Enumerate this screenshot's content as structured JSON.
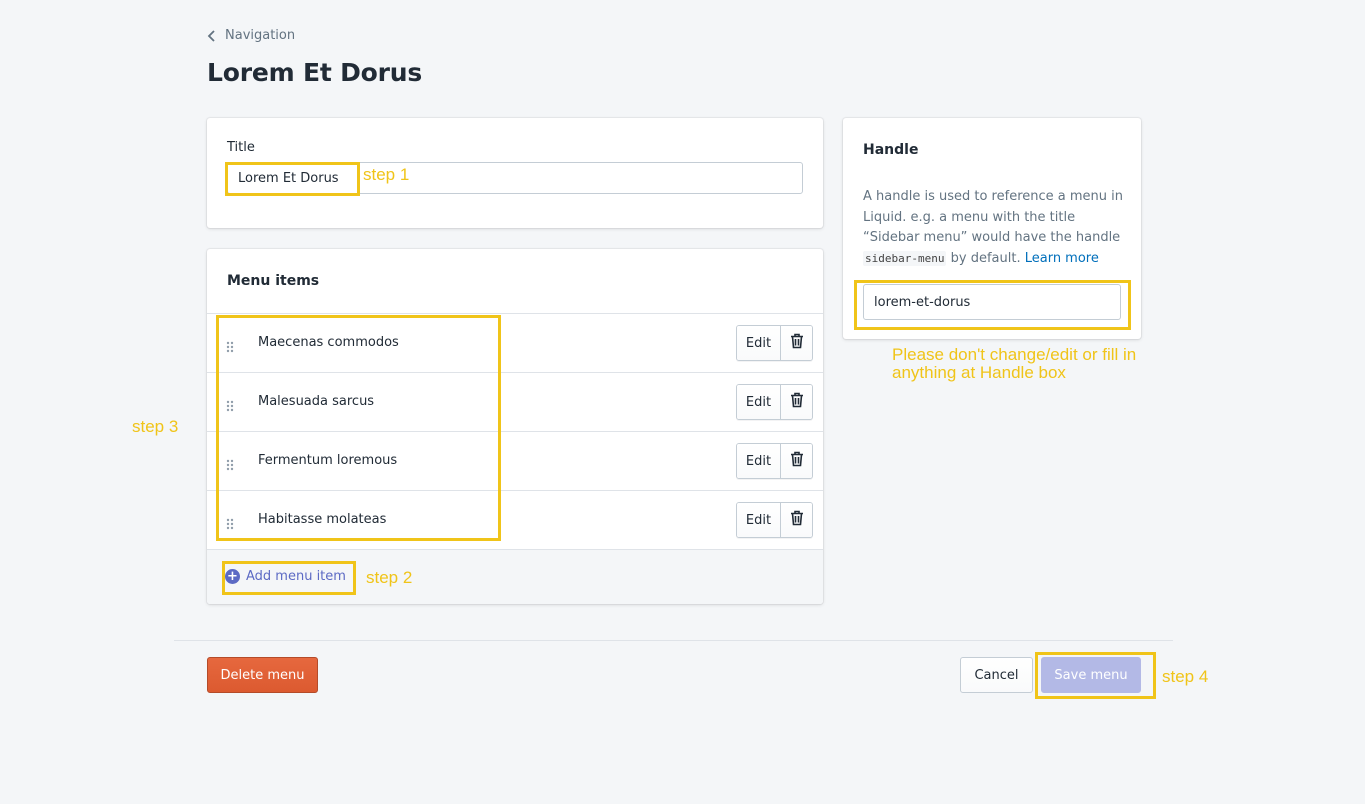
{
  "breadcrumb": {
    "label": "Navigation"
  },
  "page": {
    "title": "Lorem Et Dorus"
  },
  "title_card": {
    "label": "Title",
    "value": "Lorem Et Dorus"
  },
  "menu": {
    "header": "Menu items",
    "items": [
      {
        "label": "Maecenas commodos",
        "edit_label": "Edit"
      },
      {
        "label": "Malesuada sarcus",
        "edit_label": "Edit"
      },
      {
        "label": "Fermentum loremous",
        "edit_label": "Edit"
      },
      {
        "label": "Habitasse molateas",
        "edit_label": "Edit"
      }
    ],
    "add_label": "Add menu item"
  },
  "handle": {
    "header": "Handle",
    "desc_1": "A handle is used to reference a menu in Liquid. e.g. a menu with the title “Sidebar menu” would have the handle",
    "code": "sidebar-menu",
    "desc_2": "by default.",
    "link": "Learn more",
    "value": "lorem-et-dorus"
  },
  "actions": {
    "delete_label": "Delete menu",
    "cancel_label": "Cancel",
    "save_label": "Save menu"
  },
  "annotations": {
    "step1": "step 1",
    "step2": "step 2",
    "step3": "step 3",
    "step4": "step 4",
    "handle_note": "Please don't change/edit or fill in anything at Handle box"
  },
  "colors": {
    "accent": "#5c6ac4",
    "danger": "#de5f35",
    "annotation": "#f0c419",
    "save_disabled": "#b3b9e6"
  }
}
